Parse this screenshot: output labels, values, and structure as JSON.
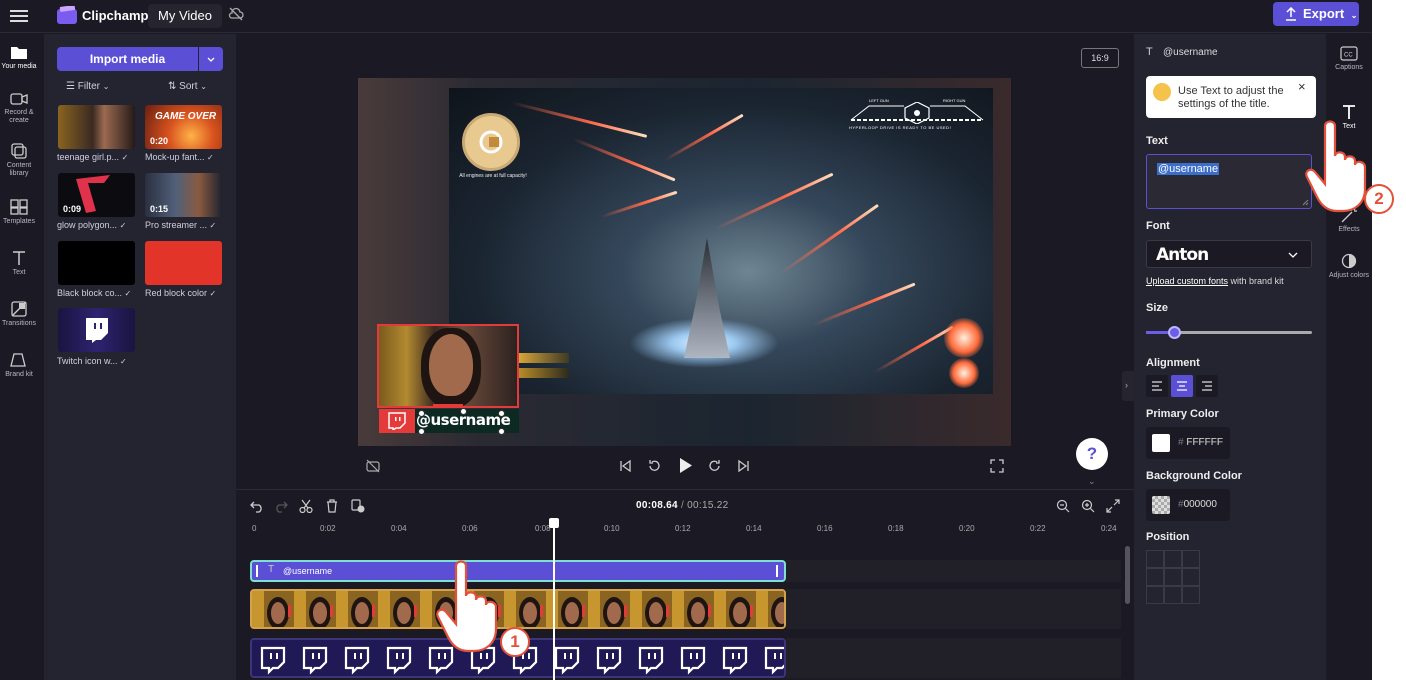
{
  "topbar": {
    "brand": "Clipchamp",
    "project": "My Video",
    "export": "Export"
  },
  "nav": [
    {
      "label": "Your media",
      "icon": "folder-icon"
    },
    {
      "label": "Record & create",
      "icon": "camera-icon"
    },
    {
      "label": "Content library",
      "icon": "library-icon"
    },
    {
      "label": "Templates",
      "icon": "templates-icon"
    },
    {
      "label": "Text",
      "icon": "text-icon"
    },
    {
      "label": "Transitions",
      "icon": "transitions-icon"
    },
    {
      "label": "Brand kit",
      "icon": "brand-kit-icon"
    }
  ],
  "media": {
    "import": "Import media",
    "filter": "Filter",
    "sort": "Sort",
    "items": [
      {
        "label": "teenage girl.p...",
        "duration": ""
      },
      {
        "label": "Mock-up fant...",
        "duration": "0:20",
        "overlay": "GAME OVER"
      },
      {
        "label": "glow polygon...",
        "duration": "0:09"
      },
      {
        "label": "Pro streamer ...",
        "duration": "0:15"
      },
      {
        "label": "Black block co...",
        "duration": ""
      },
      {
        "label": "Red block color",
        "duration": ""
      },
      {
        "label": "Twitch icon w...",
        "duration": ""
      }
    ]
  },
  "preview": {
    "ratio": "16:9",
    "hud_left": "LEFT GUN",
    "hud_right": "RIGHT GUN",
    "hud_line": "HYPERLOOP DRIVE IS READY TO BE USED!",
    "badge_text": "All engines are at full capacity!",
    "username": "@username",
    "help": "?"
  },
  "timeline": {
    "current": "00:08.64",
    "total": "00:15.22",
    "ticks": [
      "0",
      "0:02",
      "0:04",
      "0:06",
      "0:08",
      "0:10",
      "0:12",
      "0:14",
      "0:16",
      "0:18",
      "0:20",
      "0:22",
      "0:24"
    ],
    "text_clip": "@username"
  },
  "props": {
    "title": "@username",
    "tip": "Use Text to adjust the settings of the title.",
    "text_label": "Text",
    "text_value": "@username",
    "font_label": "Font",
    "font_value": "Anton",
    "upload_link": "Upload custom fonts",
    "upload_suffix": " with brand kit",
    "size_label": "Size",
    "size_value": 0.17,
    "align_label": "Alignment",
    "align_selected": "center",
    "primary_label": "Primary Color",
    "primary_hex": "FFFFFF",
    "bg_label": "Background Color",
    "bg_hex": "000000",
    "position_label": "Position"
  },
  "rail": [
    {
      "label": "Captions",
      "icon": "captions-icon"
    },
    {
      "label": "Text",
      "icon": "text-icon"
    },
    {
      "label": "Effects",
      "icon": "effects-icon"
    },
    {
      "label": "Adjust colors",
      "icon": "adjust-colors-icon"
    }
  ],
  "callouts": [
    "1",
    "2"
  ],
  "colors": {
    "accent": "#5b4fd6",
    "selection": "#7ee0d2",
    "twitch_red": "#e53a3a"
  }
}
